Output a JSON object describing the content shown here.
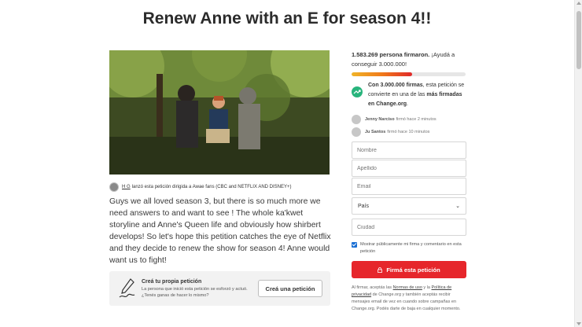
{
  "page": {
    "title": "Renew Anne with an E for season 4!!"
  },
  "creator": {
    "name": "H G",
    "text": "lanzó esta petición dirigida a Awae fans (CBC and NETFLIX AND DISNEY+)"
  },
  "description": "Guys we all loved season 3, but there is so much more we need answers to and want to see ! The whole ka'kwet storyline and Anne's Queen life and obviously how shirbert develops! So let's hope this petition catches the eye of Netflix and they decide to renew the show for season 4! Anne would want us to fight!",
  "create_card": {
    "title": "Creá tu propia petición",
    "desc": "La persona que inició esta petición se esforzó y actuó. ¿Tenés ganas de hacer lo mismo?",
    "button": "Creá una petición"
  },
  "signatures": {
    "count": "1.583.269",
    "count_suffix": "persona firmaron.",
    "cta": "¡Ayudá a conseguir 3.000.000!",
    "progress_fraction": 0.53,
    "goal_bold": "Con 3.000.000 firmas",
    "goal_mid": ", esta petición se convierte en una de las",
    "goal_bold2": "más firmadas en Change.org",
    "goal_end": "."
  },
  "recent_signers": [
    {
      "name": "Jenny Narciso",
      "time": "firmó hace 2 minutos"
    },
    {
      "name": "Ju Santos",
      "time": "firmó hace 10 minutos"
    }
  ],
  "form": {
    "first_name_placeholder": "Nombre",
    "last_name_placeholder": "Apellido",
    "email_placeholder": "Email",
    "country_label": "País",
    "city_placeholder": "Ciudad",
    "consent_text": "Mostrar públicamente mi firma y comentario en esta petición",
    "consent_checked": true,
    "sign_button": "Firmá esta petición"
  },
  "legal": {
    "p1": "Al firmar, aceptás las",
    "terms": "Normas de uso",
    "p2": "y la",
    "privacy": "Política de privacidad",
    "p3": "de Change.org y también aceptás recibir mensajes email de vez en cuando sobre campañas en Change.org. Podés darte de baja en cualquier momento."
  },
  "colors": {
    "sign_button": "#e6262b",
    "goal_icon": "#28b47c",
    "checkbox": "#1a6fd4"
  }
}
